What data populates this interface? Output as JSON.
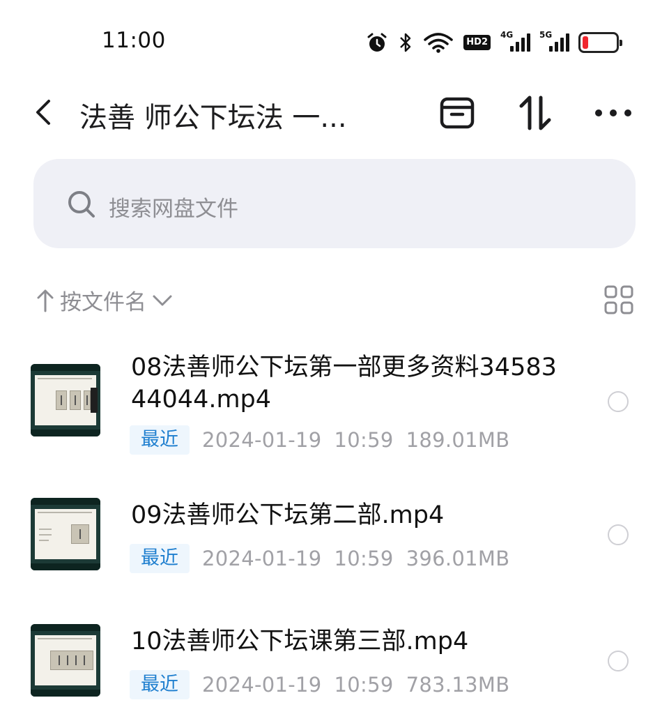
{
  "status": {
    "time": "11:00",
    "hd": "HD2",
    "net1": "4G",
    "net2": "5G",
    "battery_level": 0.08
  },
  "header": {
    "title": "法善 师公下坛法 一..."
  },
  "search": {
    "placeholder": "搜索网盘文件"
  },
  "sort": {
    "label": "按文件名"
  },
  "files": [
    {
      "name": "08法善师公下坛第一部更多资料3458344044.mp4",
      "tag": "最近",
      "date": "2024-01-19",
      "time": "10:59",
      "size": "189.01MB"
    },
    {
      "name": "09法善师公下坛第二部.mp4",
      "tag": "最近",
      "date": "2024-01-19",
      "time": "10:59",
      "size": "396.01MB"
    },
    {
      "name": "10法善师公下坛课第三部.mp4",
      "tag": "最近",
      "date": "2024-01-19",
      "time": "10:59",
      "size": "783.13MB"
    }
  ],
  "colors": {
    "accent": "#1f7fcf",
    "tag_bg": "#eef6fd",
    "search_bg": "#eff0f6",
    "battery_low": "#f0262e"
  }
}
